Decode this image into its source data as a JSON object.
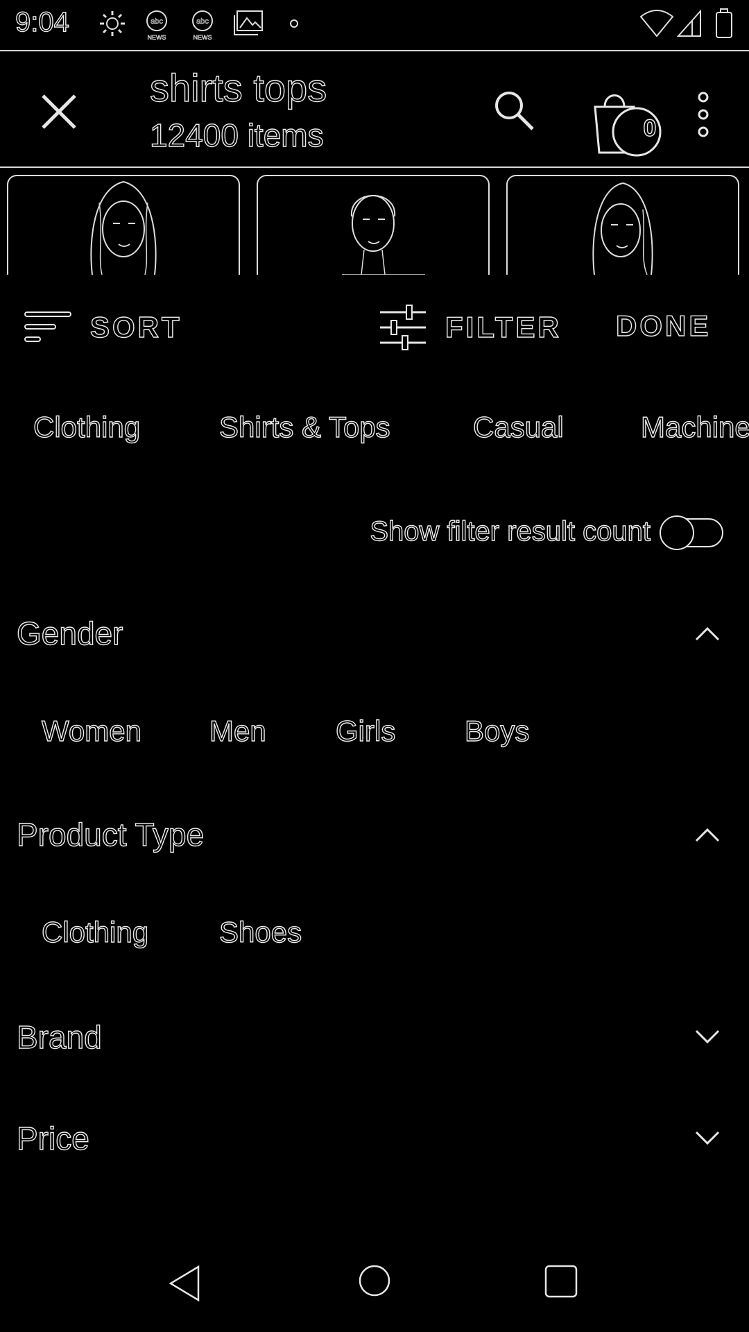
{
  "status_bar": {
    "time": "9:04",
    "icons": [
      "gear-icon",
      "abc-news-icon",
      "abc-news-icon",
      "gallery-icon",
      "dot-icon",
      "wifi-icon",
      "signal-icon",
      "battery-icon"
    ],
    "abc_label": "NEWS"
  },
  "app_bar": {
    "title": "shirts tops",
    "subtitle": "12400 items",
    "cart_count": "0"
  },
  "toolbar": {
    "sort_label": "SORT",
    "filter_label": "FILTER",
    "done_label": "DONE"
  },
  "categories": [
    "Clothing",
    "Shirts & Tops",
    "Casual",
    "Machine"
  ],
  "toggle": {
    "label": "Show filter result count",
    "on": false
  },
  "sections": {
    "gender": {
      "label": "Gender",
      "expanded": true,
      "options": [
        "Women",
        "Men",
        "Girls",
        "Boys"
      ]
    },
    "product_type": {
      "label": "Product Type",
      "expanded": true,
      "options": [
        "Clothing",
        "Shoes"
      ]
    },
    "brand": {
      "label": "Brand",
      "expanded": false
    },
    "price": {
      "label": "Price",
      "expanded": false
    }
  },
  "colors": {
    "background": "#000000",
    "outline": "#ececec"
  }
}
